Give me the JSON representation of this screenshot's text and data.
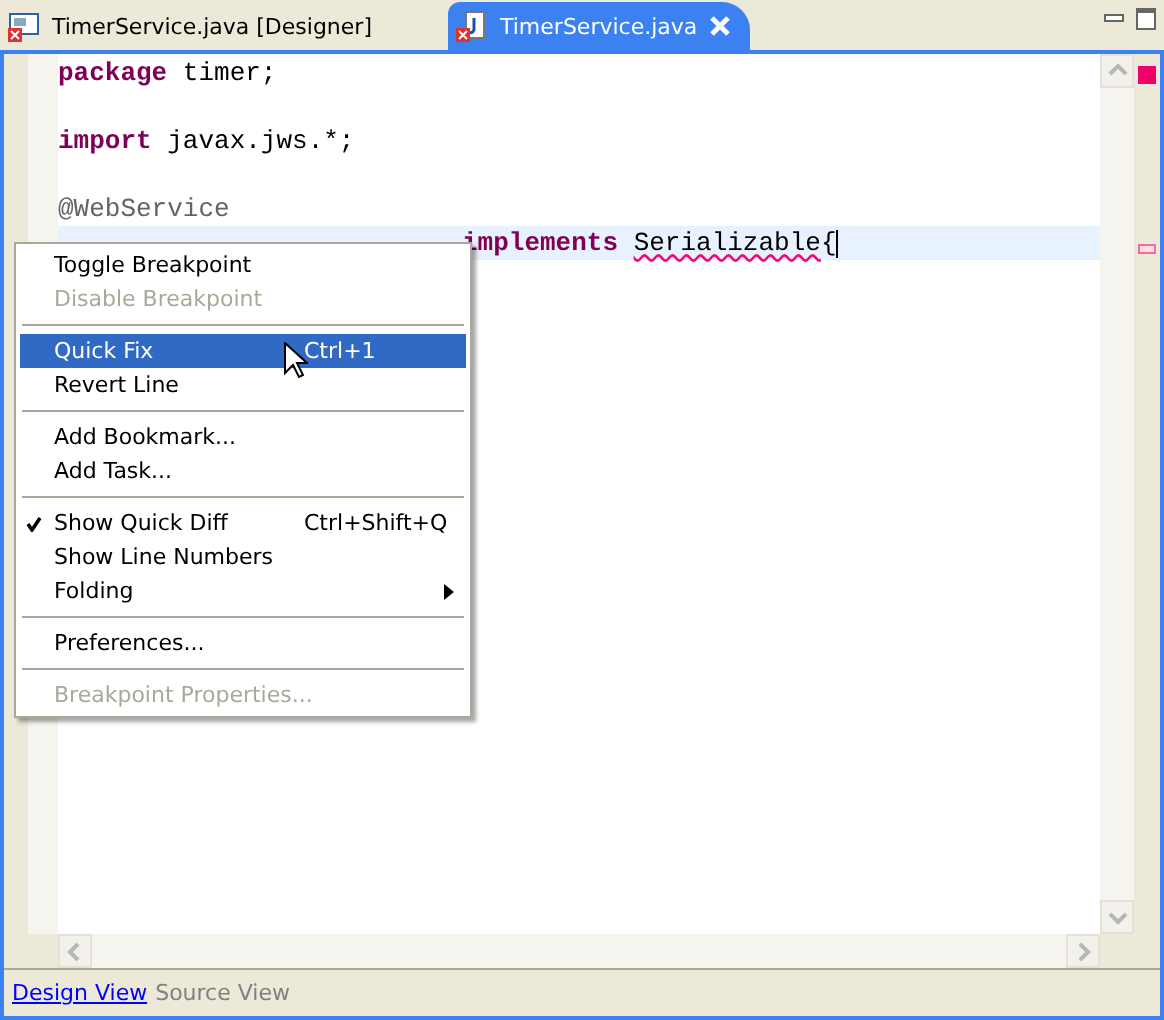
{
  "tabs": [
    {
      "label": "TimerService.java [Designer]",
      "selected": false,
      "kind": "designer"
    },
    {
      "label": "TimerService.java",
      "selected": true,
      "kind": "java"
    }
  ],
  "code_lines": [
    {
      "tokens": [
        {
          "text": "package",
          "kind": "keyword"
        },
        {
          "text": " timer;",
          "kind": "plain"
        }
      ]
    },
    {
      "kind": "blank"
    },
    {
      "tokens": [
        {
          "text": "import",
          "kind": "keyword"
        },
        {
          "text": " javax.jws.*;",
          "kind": "plain"
        }
      ]
    },
    {
      "kind": "blank"
    },
    {
      "tokens": [
        {
          "text": "@WebService",
          "kind": "annotation"
        }
      ]
    },
    {
      "current": true,
      "tokens": [
        {
          "text": "implements",
          "kind": "keyword"
        },
        {
          "text": "Serializable",
          "kind": "error"
        },
        {
          "text": "{",
          "kind": "plain"
        }
      ]
    }
  ],
  "context_menu": [
    {
      "kind": "item",
      "label": "Toggle Breakpoint",
      "disabled": false,
      "selected": false,
      "checked": false
    },
    {
      "kind": "item",
      "label": "Disable Breakpoint",
      "disabled": true,
      "selected": false,
      "checked": false
    },
    {
      "kind": "separator"
    },
    {
      "kind": "item",
      "label": "Quick Fix",
      "shortcut": "Ctrl+1",
      "disabled": false,
      "selected": true,
      "checked": false
    },
    {
      "kind": "item",
      "label": "Revert Line",
      "disabled": false,
      "selected": false,
      "checked": false
    },
    {
      "kind": "separator"
    },
    {
      "kind": "item",
      "label": "Add Bookmark...",
      "disabled": false,
      "selected": false,
      "checked": false
    },
    {
      "kind": "item",
      "label": "Add Task...",
      "disabled": false,
      "selected": false,
      "checked": false
    },
    {
      "kind": "separator"
    },
    {
      "kind": "item",
      "label": "Show Quick Diff",
      "shortcut": "Ctrl+Shift+Q",
      "disabled": false,
      "selected": false,
      "checked": true
    },
    {
      "kind": "item",
      "label": "Show Line Numbers",
      "disabled": false,
      "selected": false,
      "checked": false
    },
    {
      "kind": "submenu",
      "label": "Folding",
      "disabled": false,
      "selected": false,
      "checked": false
    },
    {
      "kind": "separator"
    },
    {
      "kind": "item",
      "label": "Preferences...",
      "disabled": false,
      "selected": false,
      "checked": false
    },
    {
      "kind": "separator"
    },
    {
      "kind": "item",
      "label": "Breakpoint Properties...",
      "disabled": true,
      "selected": false,
      "checked": false
    }
  ],
  "view_tabs": [
    {
      "label": "Design View",
      "selected": false
    },
    {
      "label": "Source View",
      "selected": true
    }
  ]
}
